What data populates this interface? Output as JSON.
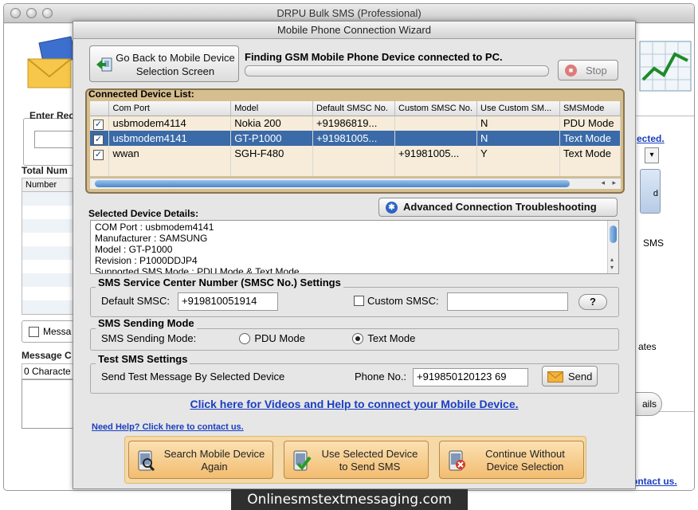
{
  "app": {
    "title": "DRPU Bulk SMS (Professional)"
  },
  "background": {
    "enter_recipient": "Enter Rec",
    "total_numbers": "Total Num",
    "number_col": "Number",
    "message_chk": "Messa",
    "message_c": "Message C",
    "characters": "0 Characte",
    "selected_link": "ected.",
    "sms_label": "SMS",
    "templates": "ates",
    "details_btn": "ails",
    "contact_link": "ontact us.",
    "side_btn": "d"
  },
  "wizard": {
    "title": "Mobile Phone Connection Wizard",
    "go_back_label": "Go Back to Mobile Device Selection Screen",
    "finding_text": "Finding GSM Mobile Phone Device connected to PC.",
    "progress": 0,
    "stop_label": "Stop",
    "connected_list_label": "Connected Device List:",
    "columns": [
      "Com Port",
      "Model",
      "Default SMSC No.",
      "Custom SMSC No.",
      "Use Custom SM...",
      "SMSMode"
    ],
    "devices": [
      {
        "checked": true,
        "com_port": "usbmodem4114",
        "model": "Nokia 200",
        "default_smsc": "+91986819...",
        "custom_smsc": "",
        "use_custom": "N",
        "mode": "PDU Mode"
      },
      {
        "checked": true,
        "com_port": "usbmodem4141",
        "model": "GT-P1000",
        "default_smsc": "+91981005...",
        "custom_smsc": "",
        "use_custom": "N",
        "mode": "Text Mode"
      },
      {
        "checked": true,
        "com_port": "wwan",
        "model": "SGH-F480",
        "default_smsc": "",
        "custom_smsc": "+91981005...",
        "use_custom": "Y",
        "mode": "Text Mode"
      }
    ],
    "troubleshoot_label": "Advanced Connection Troubleshooting",
    "selected_details_label": "Selected Device Details:",
    "details_lines": [
      "COM Port : usbmodem4141",
      "Manufacturer : SAMSUNG",
      "Model : GT-P1000",
      "Revision : P1000DDJP4",
      "Supported SMS Mode : PDU Mode & Text Mode"
    ],
    "smsc_group": "SMS Service Center Number (SMSC No.) Settings",
    "default_smsc_label": "Default SMSC:",
    "default_smsc_value": "+919810051914",
    "custom_smsc_label": "Custom SMSC:",
    "custom_smsc_value": "",
    "help_btn": "?",
    "sending_mode_group": "SMS Sending Mode",
    "sending_mode_label": "SMS Sending Mode:",
    "pdu_mode": "PDU Mode",
    "text_mode": "Text Mode",
    "test_group": "Test SMS Settings",
    "test_label": "Send Test Message By Selected Device",
    "phone_label": "Phone No.:",
    "phone_value": "+919850120123 69",
    "send_label": "Send",
    "videos_link": "Click here for Videos and Help to connect your Mobile Device.",
    "need_help_link": "Need Help? Click here to contact us.",
    "search_again": "Search Mobile Device Again",
    "use_selected": "Use Selected Device to Send SMS",
    "continue_without": "Continue Without Device Selection"
  },
  "footer": {
    "watermark": "Onlinesmstextmessaging.com"
  },
  "colors": {
    "accent_blue": "#1a3ec0",
    "button_orange": "#f2bc70",
    "selection": "#3a6aa8"
  }
}
